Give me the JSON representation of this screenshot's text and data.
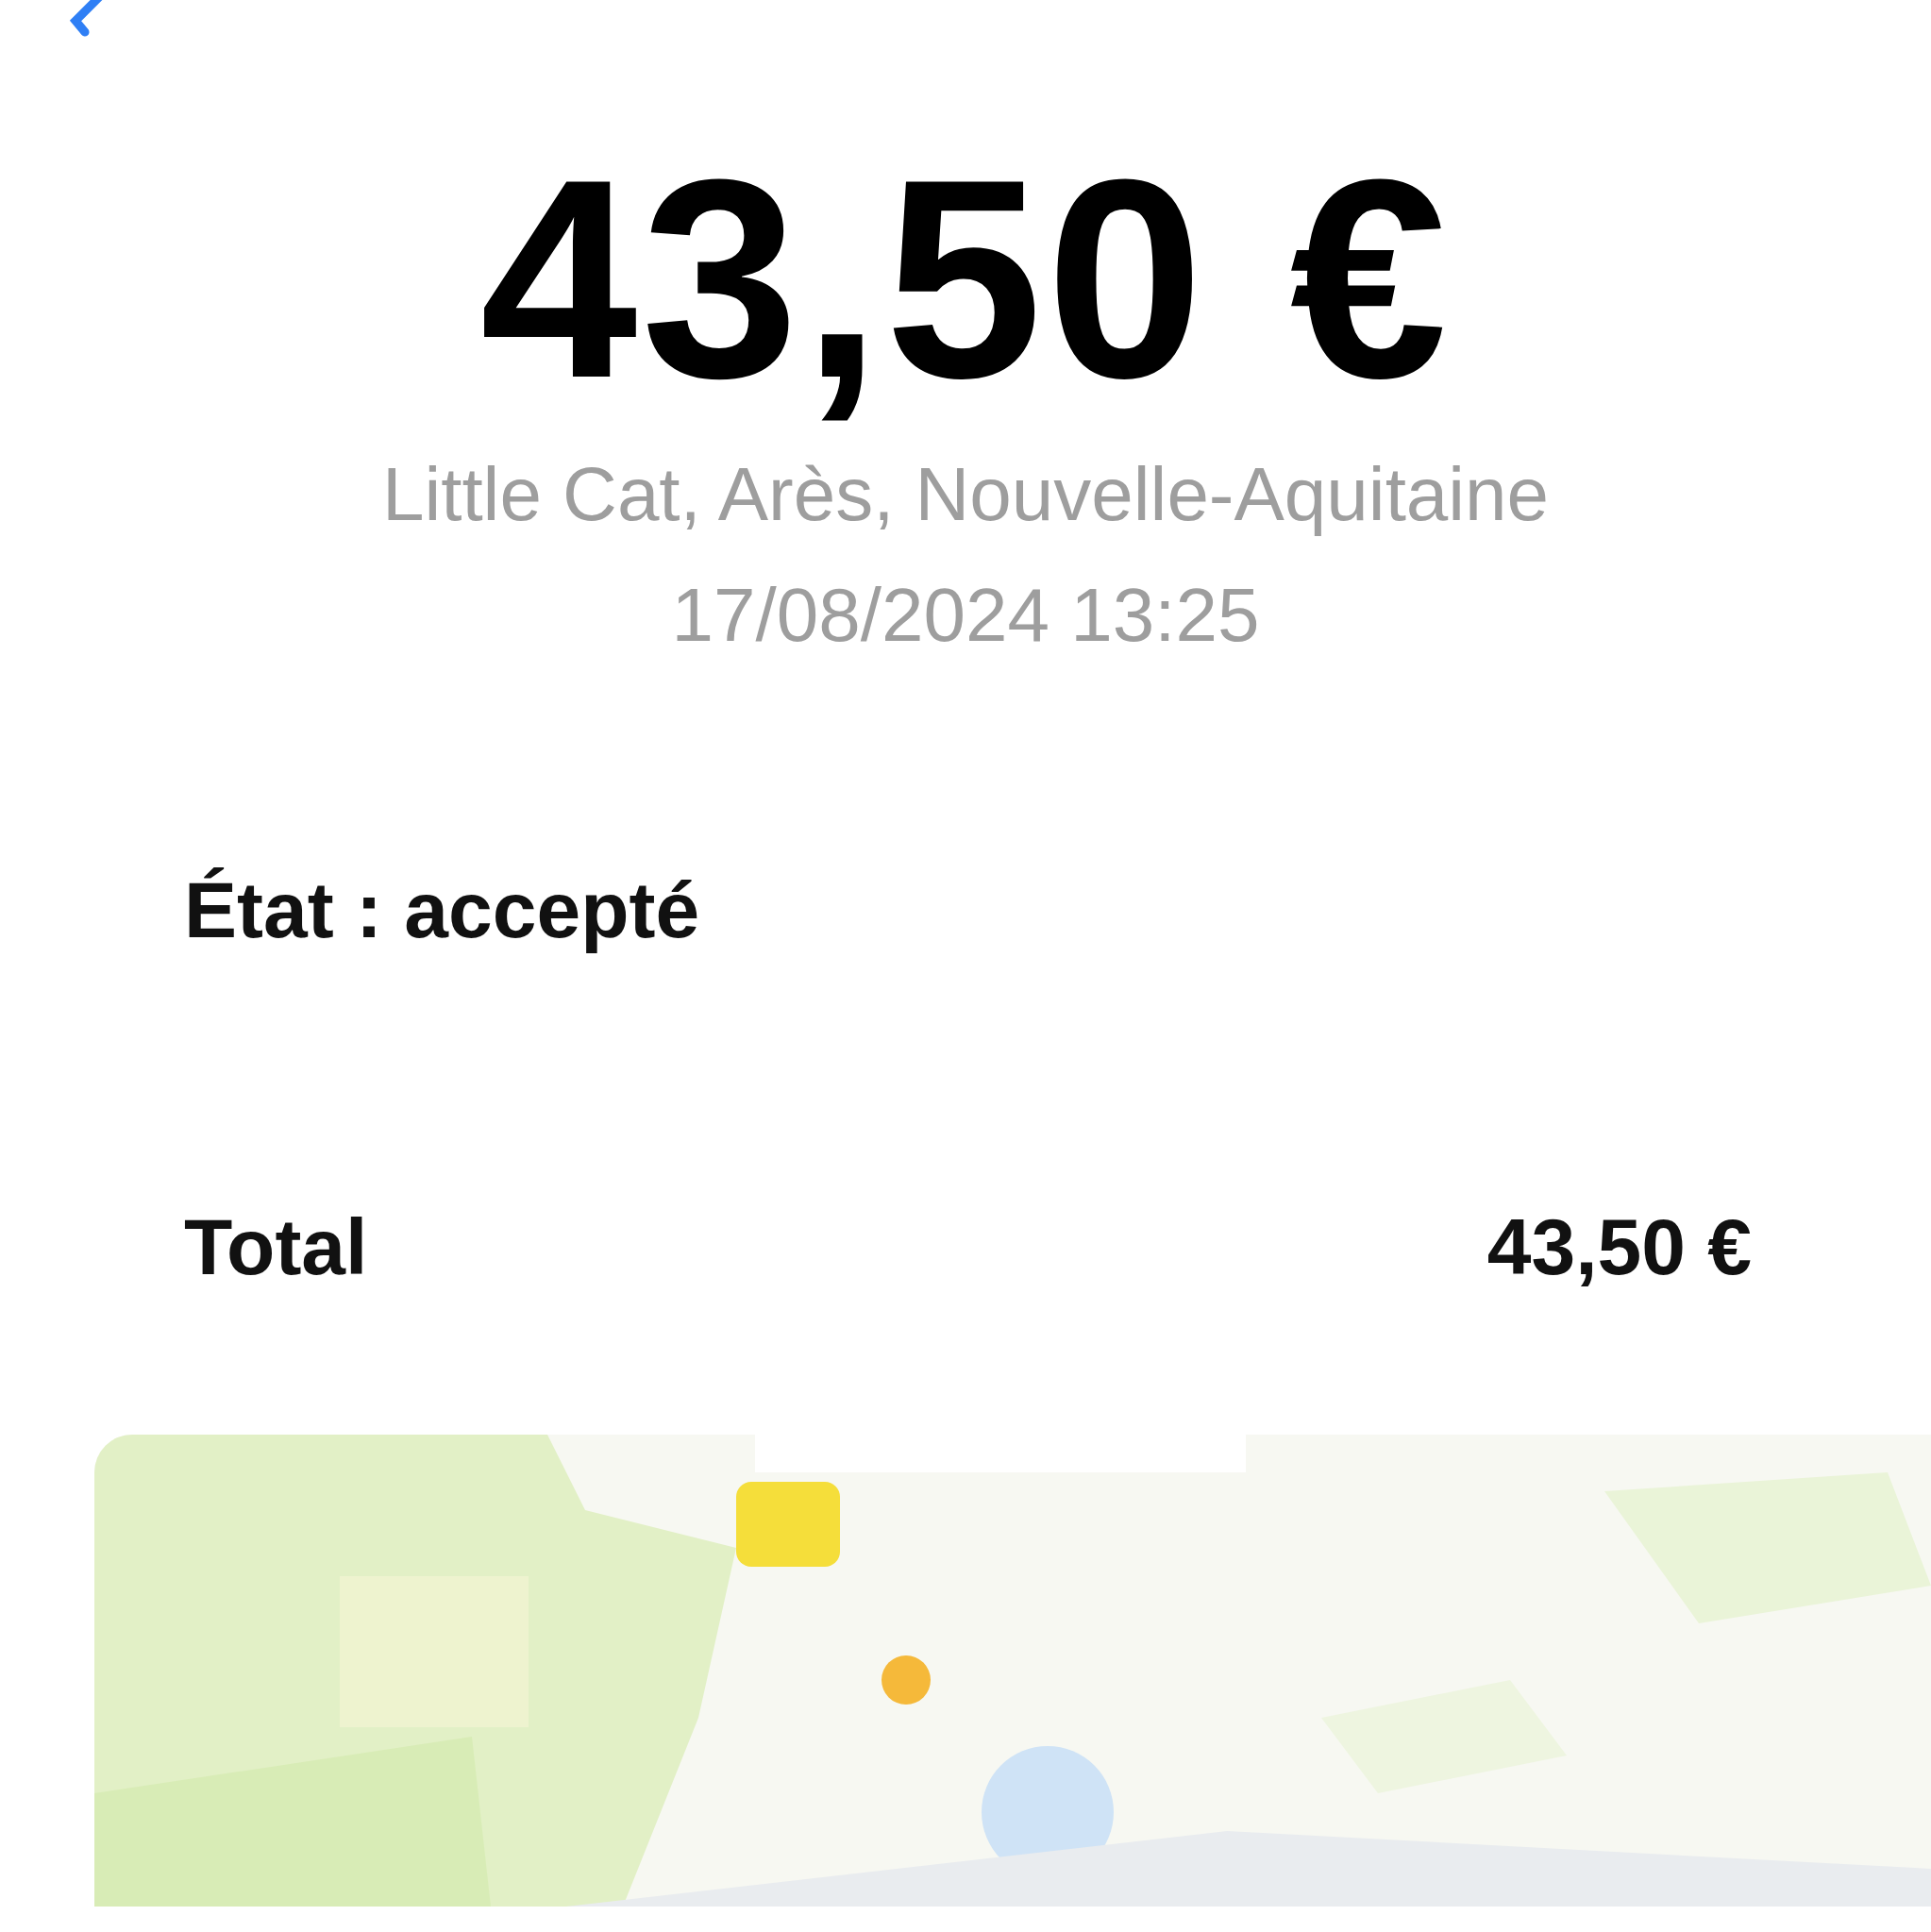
{
  "header": {
    "amount": "43,50 €",
    "location": "Little Cat, Arès, Nouvelle-Aquitaine",
    "datetime": "17/08/2024 13:25"
  },
  "status": {
    "text": "État : accepté"
  },
  "total": {
    "label": "Total",
    "value": "43,50 €"
  }
}
